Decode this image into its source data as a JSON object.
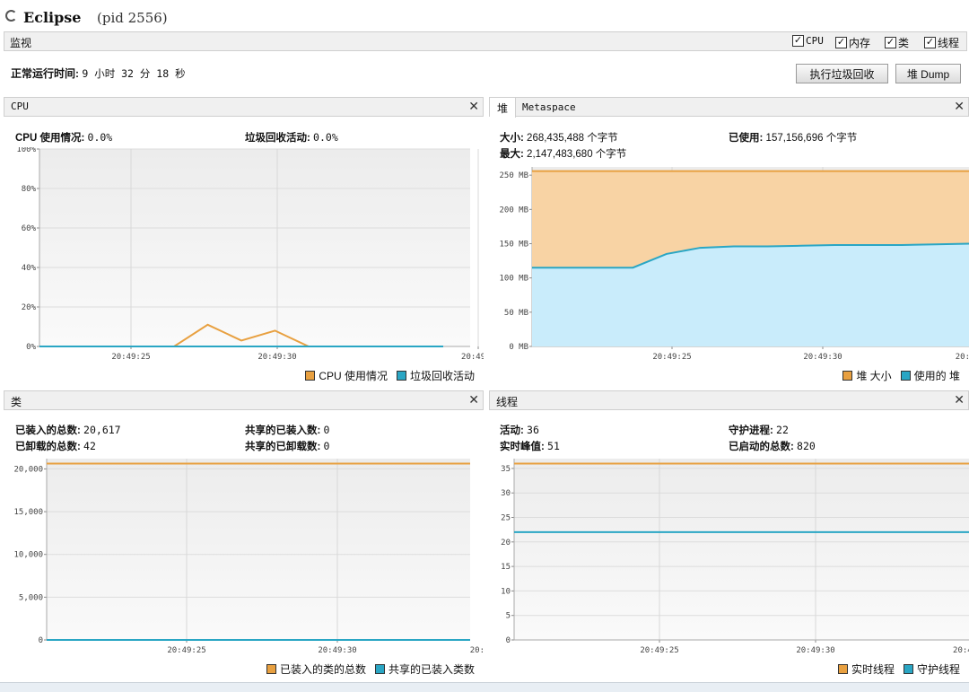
{
  "window": {
    "app_name": "Eclipse",
    "pid_text": "(pid 2556)"
  },
  "monitor_tab": {
    "label": "监视",
    "options": [
      "CPU",
      "内存",
      "类",
      "线程"
    ]
  },
  "uptime": {
    "label": "正常运行时间:",
    "value": "9 小时 32 分 18 秒"
  },
  "buttons": {
    "gc": "执行垃圾回收",
    "heap_dump": "堆 Dump"
  },
  "cpu_panel": {
    "title": "CPU",
    "usage_label": "CPU 使用情况:",
    "usage_value": "0.0%",
    "gc_label": "垃圾回收活动:",
    "gc_value": "0.0%",
    "legend": [
      "CPU 使用情况",
      "垃圾回收活动"
    ]
  },
  "heap_panel": {
    "tab_active": "堆",
    "tab_other": "Metaspace",
    "size_label": "大小:",
    "size_value": "268,435,488 个字节",
    "used_label": "已使用:",
    "used_value": "157,156,696 个字节",
    "max_label": "最大:",
    "max_value": "2,147,483,680 个字节",
    "legend": [
      "堆 大小",
      "使用的 堆"
    ]
  },
  "classes_panel": {
    "title": "类",
    "loaded_label": "已装入的总数:",
    "loaded_value": "20,617",
    "shared_loaded_label": "共享的已装入数:",
    "shared_loaded_value": "0",
    "unloaded_label": "已卸载的总数:",
    "unloaded_value": "42",
    "shared_unloaded_label": "共享的已卸载数:",
    "shared_unloaded_value": "0",
    "legend": [
      "已装入的类的总数",
      "共享的已装入类数"
    ]
  },
  "threads_panel": {
    "title": "线程",
    "live_label": "活动:",
    "live_value": "36",
    "daemon_label": "守护进程:",
    "daemon_value": "22",
    "peak_label": "实时峰值:",
    "peak_value": "51",
    "started_label": "已启动的总数:",
    "started_value": "820",
    "legend": [
      "实时线程",
      "守护线程"
    ]
  },
  "colors": {
    "orange": "#e8a040",
    "blue": "#2aa6c4",
    "orange_fill": "#f8d3a4",
    "blue_fill": "#c9ecfb",
    "plot_bg": "#f3f3f3"
  },
  "chart_data": [
    {
      "type": "line",
      "name": "cpu",
      "x": [
        "20:49:20",
        "20:49:21",
        "20:49:22",
        "20:49:23",
        "20:49:24",
        "20:49:25",
        "20:49:26",
        "20:49:27",
        "20:49:28",
        "20:49:29",
        "20:49:30",
        "20:49:31",
        "20:49:32"
      ],
      "series": [
        {
          "name": "CPU 使用情况",
          "color": "#e8a040",
          "values": [
            0,
            0,
            0,
            0,
            0,
            11,
            3,
            8,
            0,
            0,
            0,
            0,
            0
          ]
        },
        {
          "name": "垃圾回收活动",
          "color": "#2aa6c4",
          "values": [
            0,
            0,
            0,
            0,
            0,
            0,
            0,
            0,
            0,
            0,
            0,
            0,
            0
          ]
        }
      ],
      "x_ticks": [
        "20:49:25",
        "20:49:30",
        "20:49:3"
      ],
      "y_ticks": [
        "0%",
        "20%",
        "40%",
        "60%",
        "80%",
        "100%"
      ],
      "ylim": [
        0,
        100
      ],
      "grid": true
    },
    {
      "type": "area",
      "name": "heap",
      "x": [
        "20:49:22",
        "20:49:23",
        "20:49:24",
        "20:49:25",
        "20:49:26",
        "20:49:27",
        "20:49:28",
        "20:49:29",
        "20:49:30",
        "20:49:31",
        "20:49:32",
        "20:49:33",
        "20:49:34",
        "20:49:35"
      ],
      "series": [
        {
          "name": "堆 大小",
          "color": "#e8a040",
          "values": [
            256,
            256,
            256,
            256,
            256,
            256,
            256,
            256,
            256,
            256,
            256,
            256,
            256,
            256
          ]
        },
        {
          "name": "使用的 堆",
          "color": "#2aa6c4",
          "values": [
            115,
            115,
            115,
            115,
            135,
            144,
            146,
            146,
            147,
            148,
            148,
            148,
            149,
            150
          ]
        }
      ],
      "x_ticks": [
        "20:49:25",
        "20:49:30",
        "20:49:"
      ],
      "y_ticks": [
        "0 MB",
        "50 MB",
        "100 MB",
        "150 MB",
        "200 MB",
        "250 MB"
      ],
      "ylim": [
        0,
        262
      ],
      "grid": true
    },
    {
      "type": "line",
      "name": "classes",
      "x": [
        "20:49:22",
        "20:49:35"
      ],
      "series": [
        {
          "name": "已装入的类的总数",
          "color": "#e8a040",
          "values": [
            20617,
            20617
          ]
        },
        {
          "name": "共享的已装入类数",
          "color": "#2aa6c4",
          "values": [
            0,
            0
          ]
        }
      ],
      "x_ticks": [
        "20:49:25",
        "20:49:30",
        "20:49:"
      ],
      "y_ticks": [
        "0",
        "5,000",
        "10,000",
        "15,000",
        "20,000"
      ],
      "ylim": [
        0,
        21200
      ],
      "grid": true
    },
    {
      "type": "line",
      "name": "threads",
      "x": [
        "20:49:22",
        "20:49:35"
      ],
      "series": [
        {
          "name": "实时线程",
          "color": "#e8a040",
          "values": [
            36,
            36
          ]
        },
        {
          "name": "守护线程",
          "color": "#2aa6c4",
          "values": [
            22,
            22
          ]
        }
      ],
      "x_ticks": [
        "20:49:25",
        "20:49:30",
        "20:49:3"
      ],
      "y_ticks": [
        "0",
        "5",
        "10",
        "15",
        "20",
        "25",
        "30",
        "35"
      ],
      "ylim": [
        0,
        37
      ],
      "grid": true
    }
  ]
}
